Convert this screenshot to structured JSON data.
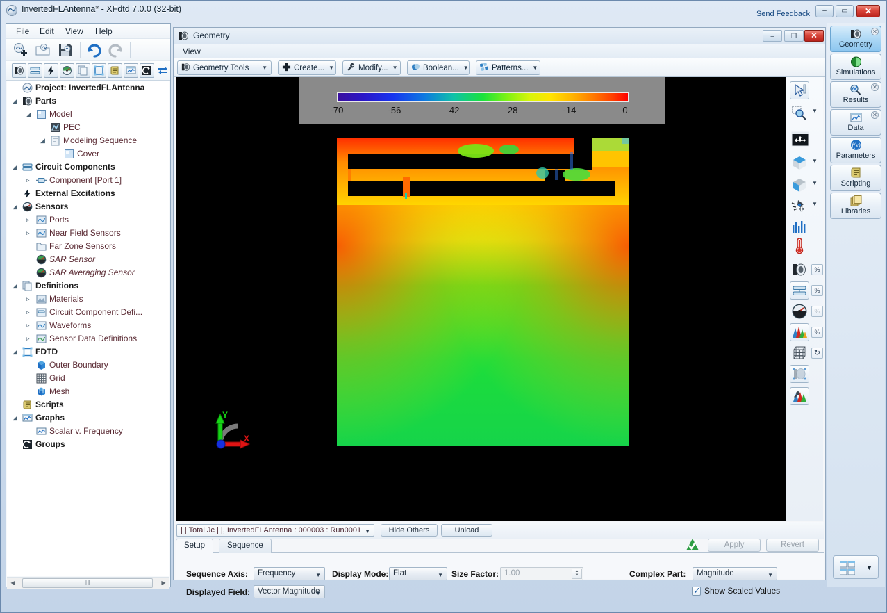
{
  "window": {
    "title": "InvertedFLAntenna* - XFdtd 7.0.0 (32-bit)",
    "send_feedback": "Send Feedback",
    "minimize": "–",
    "maximize": "▭",
    "close": "✕"
  },
  "menu": {
    "file": "File",
    "edit": "Edit",
    "view": "View",
    "help": "Help"
  },
  "toolbar_main": [
    {
      "name": "new-project-icon"
    },
    {
      "name": "open-project-icon"
    },
    {
      "name": "save-project-icon"
    },
    {
      "name": "undo-icon"
    },
    {
      "name": "redo-icon"
    }
  ],
  "toolbar_secondary": [
    {
      "name": "parts-icon"
    },
    {
      "name": "circuit-components-icon"
    },
    {
      "name": "external-excitations-icon"
    },
    {
      "name": "sensors-icon"
    },
    {
      "name": "definitions-icon"
    },
    {
      "name": "fdtd-icon"
    },
    {
      "name": "scripts-icon"
    },
    {
      "name": "graphs-icon"
    },
    {
      "name": "groups-icon"
    },
    {
      "name": "refresh-icon"
    }
  ],
  "tree": [
    {
      "label": "Project: InvertedFLAntenna",
      "indent": 0,
      "arrow": "",
      "icon": "project-icon",
      "bold": true,
      "italic": false
    },
    {
      "label": "Parts",
      "indent": 0,
      "arrow": "◢",
      "icon": "parts-icon",
      "bold": true,
      "italic": false
    },
    {
      "label": "Model",
      "indent": 1,
      "arrow": "◢",
      "icon": "model-icon",
      "bold": false,
      "italic": false
    },
    {
      "label": "PEC",
      "indent": 2,
      "arrow": "",
      "icon": "pec-icon",
      "bold": false,
      "italic": false
    },
    {
      "label": "Modeling Sequence",
      "indent": 2,
      "arrow": "◢",
      "icon": "sequence-icon",
      "bold": false,
      "italic": false
    },
    {
      "label": "Cover",
      "indent": 3,
      "arrow": "",
      "icon": "cover-icon",
      "bold": false,
      "italic": false
    },
    {
      "label": "Circuit Components",
      "indent": 0,
      "arrow": "◢",
      "icon": "circuit-components-icon",
      "bold": true,
      "italic": false
    },
    {
      "label": "Component [Port 1]",
      "indent": 1,
      "arrow": "▹",
      "icon": "component-icon",
      "bold": false,
      "italic": false
    },
    {
      "label": "External Excitations",
      "indent": 0,
      "arrow": "",
      "icon": "excitation-icon",
      "bold": true,
      "italic": false
    },
    {
      "label": "Sensors",
      "indent": 0,
      "arrow": "◢",
      "icon": "sensors-icon",
      "bold": true,
      "italic": false
    },
    {
      "label": "Ports",
      "indent": 1,
      "arrow": "▹",
      "icon": "ports-icon",
      "bold": false,
      "italic": false
    },
    {
      "label": "Near Field Sensors",
      "indent": 1,
      "arrow": "▹",
      "icon": "near-field-sensors-icon",
      "bold": false,
      "italic": false
    },
    {
      "label": "Far Zone Sensors",
      "indent": 1,
      "arrow": "",
      "icon": "far-zone-sensors-icon",
      "bold": false,
      "italic": false
    },
    {
      "label": "SAR Sensor",
      "indent": 1,
      "arrow": "",
      "icon": "sar-sensor-icon",
      "bold": false,
      "italic": true
    },
    {
      "label": "SAR Averaging Sensor",
      "indent": 1,
      "arrow": "",
      "icon": "sar-averaging-sensor-icon",
      "bold": false,
      "italic": true
    },
    {
      "label": "Definitions",
      "indent": 0,
      "arrow": "◢",
      "icon": "definitions-icon",
      "bold": true,
      "italic": false
    },
    {
      "label": "Materials",
      "indent": 1,
      "arrow": "▹",
      "icon": "materials-icon",
      "bold": false,
      "italic": false
    },
    {
      "label": "Circuit Component Defi...",
      "indent": 1,
      "arrow": "▹",
      "icon": "circuit-component-definitions-icon",
      "bold": false,
      "italic": false
    },
    {
      "label": "Waveforms",
      "indent": 1,
      "arrow": "▹",
      "icon": "waveforms-icon",
      "bold": false,
      "italic": false
    },
    {
      "label": "Sensor Data Definitions",
      "indent": 1,
      "arrow": "▹",
      "icon": "sensor-data-definitions-icon",
      "bold": false,
      "italic": false
    },
    {
      "label": "FDTD",
      "indent": 0,
      "arrow": "◢",
      "icon": "fdtd-icon",
      "bold": true,
      "italic": false
    },
    {
      "label": "Outer Boundary",
      "indent": 1,
      "arrow": "",
      "icon": "outer-boundary-icon",
      "bold": false,
      "italic": false
    },
    {
      "label": "Grid",
      "indent": 1,
      "arrow": "",
      "icon": "grid-icon",
      "bold": false,
      "italic": false
    },
    {
      "label": "Mesh",
      "indent": 1,
      "arrow": "",
      "icon": "mesh-icon",
      "bold": false,
      "italic": false
    },
    {
      "label": "Scripts",
      "indent": 0,
      "arrow": "",
      "icon": "scripts-icon",
      "bold": true,
      "italic": false
    },
    {
      "label": "Graphs",
      "indent": 0,
      "arrow": "◢",
      "icon": "graphs-icon",
      "bold": true,
      "italic": false
    },
    {
      "label": "Scalar v. Frequency",
      "indent": 1,
      "arrow": "",
      "icon": "graph-item-icon",
      "bold": false,
      "italic": false
    },
    {
      "label": "Groups",
      "indent": 0,
      "arrow": "",
      "icon": "groups-icon",
      "bold": true,
      "italic": false
    }
  ],
  "geometry_window": {
    "title": "Geometry",
    "menu_view": "View",
    "minimize": "–",
    "maximize": "❐",
    "close": "✕",
    "tools": [
      {
        "label": "Geometry Tools",
        "icon": "geometry-tools-icon"
      },
      {
        "label": "Create...",
        "icon": "create-plus-icon"
      },
      {
        "label": "Modify...",
        "icon": "modify-wrench-icon"
      },
      {
        "label": "Boolean...",
        "icon": "boolean-circles-icon"
      },
      {
        "label": "Patterns...",
        "icon": "patterns-icon"
      }
    ]
  },
  "chart_data": {
    "type": "heatmap",
    "title": "",
    "colorbar_label": "",
    "ticks": [
      "-70",
      "-56",
      "-42",
      "-28",
      "-14",
      "0"
    ],
    "range": [
      -70,
      0
    ],
    "colormap": [
      "#3b0f9e",
      "#1734ef",
      "#0fc2a8",
      "#1ae23c",
      "#d6f50a",
      "#ffb300",
      "#ff0000"
    ],
    "axes_indicator": {
      "x_label": "X",
      "y_label": "Y"
    }
  },
  "data_selector": {
    "value": "| | Total  Jc | |, InvertedFLAntenna : 000003 : Run0001",
    "hide_others": "Hide Others",
    "unload": "Unload"
  },
  "setup": {
    "tabs": [
      {
        "label": "Setup",
        "active": true
      },
      {
        "label": "Sequence",
        "active": false
      }
    ],
    "apply": "Apply",
    "revert": "Revert",
    "fields": {
      "sequence_axis_label": "Sequence Axis:",
      "sequence_axis_value": "Frequency",
      "display_mode_label": "Display Mode:",
      "display_mode_value": "Flat",
      "size_factor_label": "Size Factor:",
      "size_factor_value": "1.00",
      "displayed_field_label": "Displayed Field:",
      "displayed_field_value": "Vector Magnitude",
      "complex_part_label": "Complex Part:",
      "complex_part_value": "Magnitude",
      "show_scaled_label": "Show Scaled Values",
      "show_scaled_checked": "✓"
    }
  },
  "right_rail": [
    {
      "label": "Geometry",
      "icon": "geometry-icon",
      "active": true,
      "closable": true
    },
    {
      "label": "Simulations",
      "icon": "simulations-icon",
      "active": false,
      "closable": false
    },
    {
      "label": "Results",
      "icon": "results-icon",
      "active": false,
      "closable": true
    },
    {
      "label": "Data",
      "icon": "data-icon",
      "active": false,
      "closable": true
    },
    {
      "label": "Parameters",
      "icon": "parameters-fx-icon",
      "active": false,
      "closable": false
    },
    {
      "label": "Scripting",
      "icon": "scripting-icon",
      "active": false,
      "closable": false
    },
    {
      "label": "Libraries",
      "icon": "libraries-icon",
      "active": false,
      "closable": false
    }
  ],
  "view_tools": [
    {
      "name": "select-arrow-icon",
      "caret": false,
      "percent": false
    },
    {
      "name": "zoom-region-icon",
      "caret": true,
      "percent": false
    },
    {
      "name": "pan-move-icon",
      "caret": false,
      "percent": false
    },
    {
      "name": "view-direction-cube-icon",
      "caret": true,
      "percent": false
    },
    {
      "name": "view-orientation-cube-icon",
      "caret": true,
      "percent": false
    },
    {
      "name": "pick-point-icon",
      "caret": true,
      "percent": false
    },
    {
      "name": "histogram-icon",
      "caret": false,
      "percent": false
    },
    {
      "name": "thermometer-icon",
      "caret": false,
      "percent": false
    },
    {
      "name": "parts-visibility-icon",
      "caret": false,
      "percent": true
    },
    {
      "name": "circuit-visibility-icon",
      "caret": false,
      "percent": true
    },
    {
      "name": "sensor-visibility-icon",
      "caret": false,
      "percent": true
    },
    {
      "name": "field-visibility-icon",
      "caret": false,
      "percent": true
    },
    {
      "name": "grid-visibility-icon",
      "caret": false,
      "percent": true
    },
    {
      "name": "parts-transparency-icon",
      "caret": false,
      "percent": false
    },
    {
      "name": "field-settings-icon",
      "caret": false,
      "percent": false
    }
  ],
  "scrollbar": {
    "left_arrow": "◀",
    "right_arrow": "▶",
    "grip": "‖‖"
  },
  "layout_button": {
    "caret": "▼"
  },
  "percent_symbol": "%"
}
